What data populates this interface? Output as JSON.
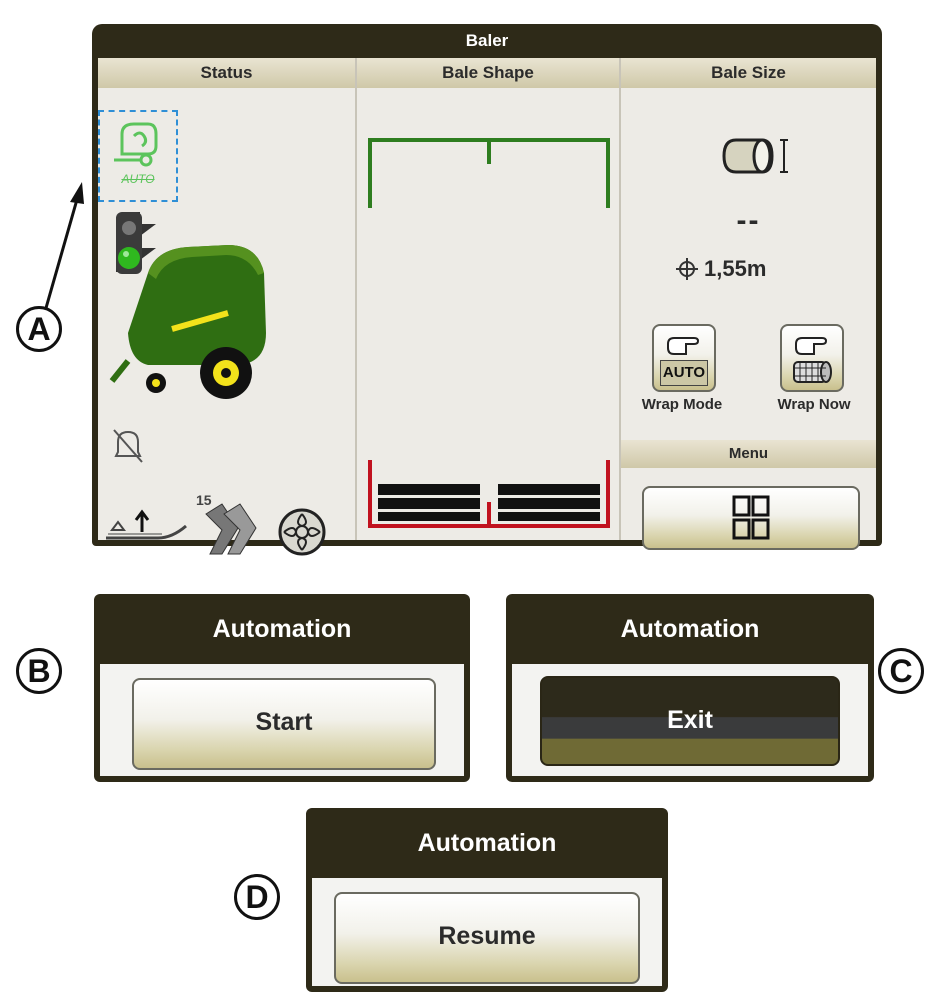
{
  "baler_panel": {
    "title": "Baler",
    "columns": {
      "status": "Status",
      "bale_shape": "Bale Shape",
      "bale_size": "Bale Size"
    },
    "status": {
      "automation_icon_text": "AUTO",
      "counter_value": "15"
    },
    "bale_size": {
      "size_readout": "--",
      "diameter_value": "1,55m",
      "wrap_mode": {
        "button_text": "AUTO",
        "label": "Wrap Mode"
      },
      "wrap_now": {
        "label": "Wrap Now"
      },
      "menu_header": "Menu"
    }
  },
  "callouts": {
    "a": "A",
    "b": "B",
    "c": "C",
    "d": "D"
  },
  "automation_panels": [
    {
      "header": "Automation",
      "button": "Start"
    },
    {
      "header": "Automation",
      "button": "Exit"
    },
    {
      "header": "Automation",
      "button": "Resume"
    }
  ],
  "colors": {
    "panel_dark": "#2e2a18",
    "baler_green": "#2f6e12",
    "indicator_green": "#2fb81f",
    "shape_green": "#2e7d1f",
    "shape_red": "#c1121f",
    "auto_highlight": "#2f8fd6"
  }
}
